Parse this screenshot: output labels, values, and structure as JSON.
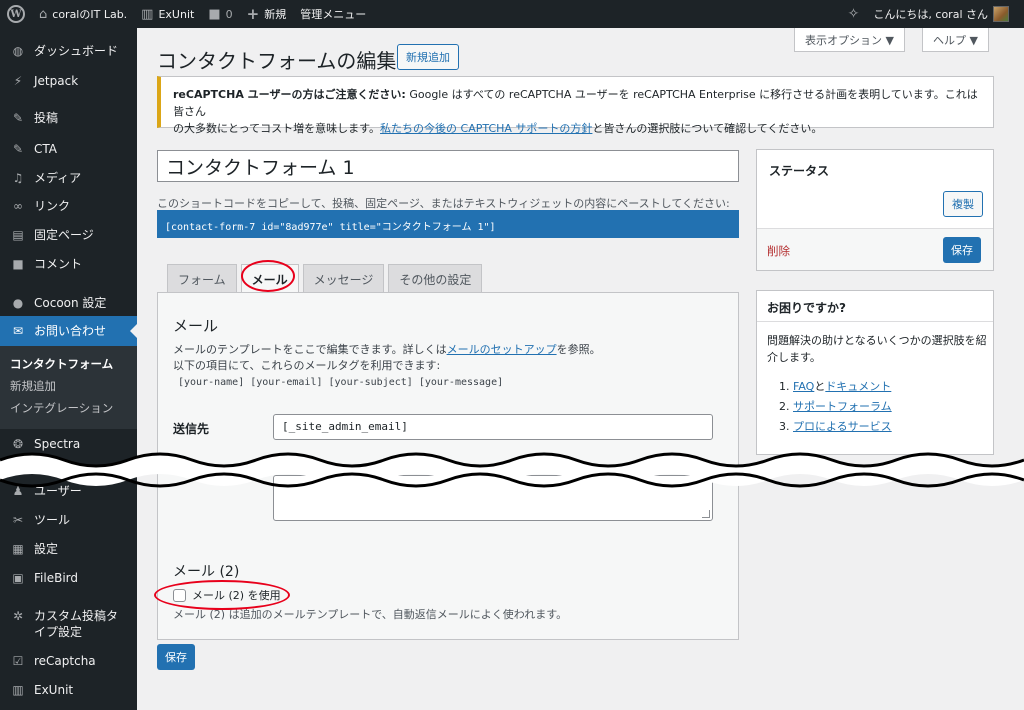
{
  "admin_bar": {
    "site_name": "coralのIT Lab.",
    "exunit": "ExUnit",
    "comments_count": "0",
    "new_label": "新規",
    "admin_menu": "管理メニュー",
    "greeting": "こんにちは, coral さん"
  },
  "sidebar": {
    "items": [
      {
        "label": "ダッシュボード",
        "icon": "dashboard-icon"
      },
      {
        "label": "Jetpack",
        "icon": "jetpack-icon"
      },
      {
        "label": "投稿",
        "icon": "pin-icon"
      },
      {
        "label": "CTA",
        "icon": "pin-icon"
      },
      {
        "label": "メディア",
        "icon": "media-icon"
      },
      {
        "label": "リンク",
        "icon": "link-icon"
      },
      {
        "label": "固定ページ",
        "icon": "page-icon"
      },
      {
        "label": "コメント",
        "icon": "comment-icon"
      },
      {
        "label": "Cocoon 設定",
        "icon": "cocoon-icon"
      },
      {
        "label": "お問い合わせ",
        "icon": "mail-icon"
      },
      {
        "label": "Spectra",
        "icon": "spectra-icon"
      },
      {
        "label": "ユーザー",
        "icon": "user-icon"
      },
      {
        "label": "ツール",
        "icon": "tools-icon"
      },
      {
        "label": "設定",
        "icon": "settings-icon"
      },
      {
        "label": "FileBird",
        "icon": "filebird-icon"
      },
      {
        "label": "カスタム投稿タイプ設定",
        "icon": "gear-icon"
      },
      {
        "label": "reCaptcha",
        "icon": "recaptcha-icon"
      },
      {
        "label": "ExUnit",
        "icon": "exunit-icon"
      }
    ],
    "submenu": [
      "コンタクトフォーム",
      "新規追加",
      "インテグレーション"
    ]
  },
  "header": {
    "title": "コンタクトフォームの編集",
    "add_new": "新規追加",
    "screen_options": "表示オプション ▼",
    "help": "ヘルプ ▼"
  },
  "notice": {
    "bold": "reCAPTCHA ユーザーの方はご注意ください:",
    "text1": " Google はすべての reCAPTCHA ユーザーを reCAPTCHA Enterprise に移行させる計画を表明しています。これは皆さん",
    "text2": "の大多数にとってコスト増を意味します。",
    "link": "私たちの今後の CAPTCHA サポートの方針",
    "text3": "と皆さんの選択肢について確認してください。"
  },
  "form": {
    "title": "コンタクトフォーム 1",
    "shortcode_hint": "このショートコードをコピーして、投稿、固定ページ、またはテキストウィジェットの内容にペーストしてください:",
    "shortcode": "[contact-form-7 id=\"8ad977e\" title=\"コンタクトフォーム 1\"]"
  },
  "tabs": [
    "フォーム",
    "メール",
    "メッセージ",
    "その他の設定"
  ],
  "mail_panel": {
    "heading": "メール",
    "desc1": "メールのテンプレートをここで編集できます。詳しくは",
    "desc_link": "メールのセットアップ",
    "desc2": "を参照。",
    "desc3": "以下の項目にて、これらのメールタグを利用できます:",
    "tags": "[your-name] [your-email] [your-subject] [your-message]",
    "to_label": "送信先",
    "to_value": "[_site_admin_email]",
    "mail2_heading": "メール (2)",
    "mail2_checkbox": "メール (2) を使用",
    "mail2_note": "メール (2) は追加のメールテンプレートで、自動返信メールによく使われます。"
  },
  "save_button": "保存",
  "status_box": {
    "title": "ステータス",
    "duplicate": "複製",
    "delete": "削除",
    "save": "保存"
  },
  "help_box": {
    "title": "お困りですか?",
    "intro": "問題解決の助けとなるいくつかの選択肢を紹介します。",
    "items": [
      {
        "num": "1",
        "link1": "FAQ",
        "join": "と",
        "link2": "ドキュメント"
      },
      {
        "num": "2",
        "link1": "サポートフォーラム"
      },
      {
        "num": "3",
        "link1": "プロによるサービス"
      }
    ]
  },
  "colors": {
    "admin_dark": "#1d2327",
    "accent": "#2271b1",
    "notice_border": "#dba617",
    "annotation": "#e8001b",
    "delete": "#b32d2e"
  }
}
